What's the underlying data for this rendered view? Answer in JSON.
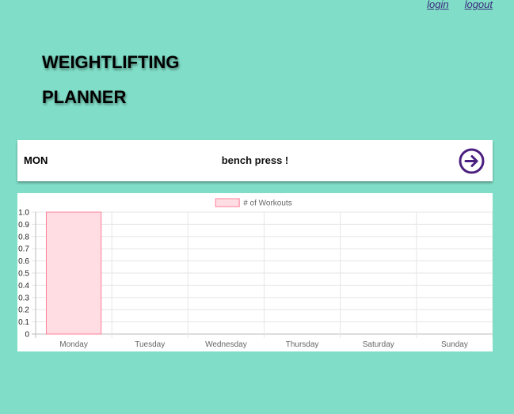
{
  "nav": {
    "login_label": "login",
    "logout_label": "logout"
  },
  "header": {
    "title_line1": "WEIGHTLIFTING",
    "title_line2": "PLANNER"
  },
  "day_card": {
    "day": "MON",
    "workout": "bench press !",
    "next_icon": "arrow-right-circle-icon",
    "accent_color": "#4a1f80"
  },
  "colors": {
    "background": "#80dec8",
    "bar_fill": "#ffdde3",
    "bar_stroke": "#ff7f99"
  },
  "chart_data": {
    "type": "bar",
    "categories": [
      "Monday",
      "Tuesday",
      "Wednesday",
      "Thursday",
      "Saturday",
      "Sunday"
    ],
    "series": [
      {
        "name": "# of Workouts",
        "values": [
          1,
          0,
          0,
          0,
          0,
          0
        ]
      }
    ],
    "y_tick_labels": [
      "1.0",
      "0.9",
      "0.8",
      "0.7",
      "0.6",
      "0.5",
      "0.4",
      "0.3",
      "0.2",
      "0.1",
      "0"
    ],
    "ylim": [
      0,
      1
    ],
    "grid": true,
    "legend": "top"
  }
}
